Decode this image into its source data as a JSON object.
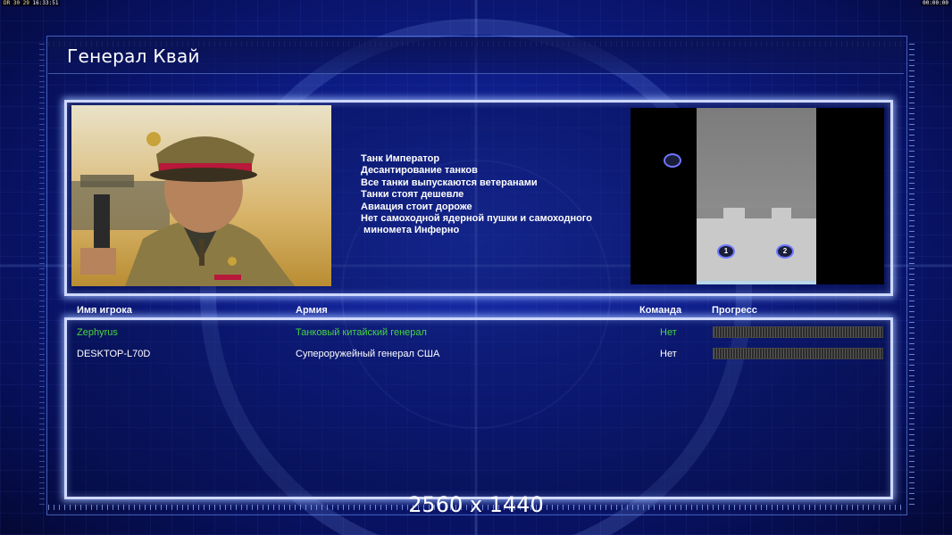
{
  "hud": {
    "left_text_yellow": "DR 30 29",
    "left_text_white": "16:33:51",
    "right_text": "00:00:00"
  },
  "general_name": "Генерал Квай",
  "abilities": [
    "Танк Император",
    "Десантирование танков",
    "Все танки выпускаются ветеранами",
    "Танки стоят дешевле",
    "Авиация стоит дороже",
    "Нет самоходной ядерной пушки и самоходного",
    " минoмета Инферно"
  ],
  "minimap": {
    "start_positions": [
      "1",
      "2"
    ]
  },
  "players_table": {
    "headers": {
      "player": "Имя игрока",
      "army": "Армия",
      "team": "Команда",
      "progress": "Прогресс"
    },
    "rows": [
      {
        "player": "Zephyrus",
        "army": "Танковый китайский генерал",
        "team": "Нет",
        "progress": 1.0,
        "highlight": "#47d63d"
      },
      {
        "player": "DESKTOP-L70D",
        "army": "Супероружейный генерал США",
        "team": "Нет",
        "progress": 1.0,
        "highlight": "#ffffff"
      }
    ]
  },
  "resolution_label": "2560 x 1440"
}
